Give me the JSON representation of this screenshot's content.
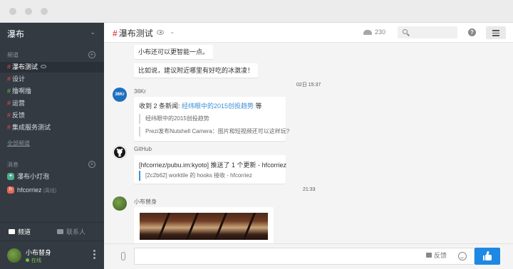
{
  "sidebar": {
    "team_name": "瀑布",
    "channels_title": "频道",
    "channels": [
      {
        "label": "瀑布测试",
        "active": true
      },
      {
        "label": "设计"
      },
      {
        "label": "撸啊撸"
      },
      {
        "label": "运营"
      },
      {
        "label": "反馈"
      },
      {
        "label": "集成服务测试"
      }
    ],
    "all_channels_link": "全部频道",
    "messages_title": "消息",
    "dms": [
      {
        "label": "瀑布小灯泡",
        "sub": "",
        "color": "#4caf8a",
        "glyph": "✦"
      },
      {
        "label": "hfcorriez",
        "sub": "(离线)",
        "color": "#e06a5a",
        "glyph": "h"
      }
    ],
    "tabs": {
      "channels": "频道",
      "contacts": "联系人"
    },
    "me": {
      "name": "小布替身",
      "status": "在线"
    }
  },
  "header": {
    "channel_name": "瀑布测试",
    "member_count": "230",
    "search_placeholder": ""
  },
  "messages": {
    "bubble1": "小布还可以更智能一点。",
    "bubble2": "比如说，建议附近哪里有好吃的冰激凌！",
    "time1": "02日 15:37",
    "kr": {
      "avatar_text": "36Kr",
      "sender": "36Kr",
      "title_prefix": "收到 2 条新闻: ",
      "title_link": "经纬眼中的2015创投趋势",
      "title_suffix": " 等",
      "items": [
        "经纬眼中的2015创投趋势",
        "Prezi发布Nutshell Camera：图片和短视频还可以这样玩?"
      ]
    },
    "github": {
      "sender": "GitHub",
      "title": "[hfcorriez/pubu.im:kyoto] 推送了 1 个更新 - hfcorriez",
      "commit": "[2c2b62] worktile 的 hooks 接收 - hfcorriez"
    },
    "time2": "21:33",
    "bot": {
      "sender": "小布替身"
    }
  },
  "composer": {
    "feedback_label": "反馈",
    "placeholder": ""
  }
}
